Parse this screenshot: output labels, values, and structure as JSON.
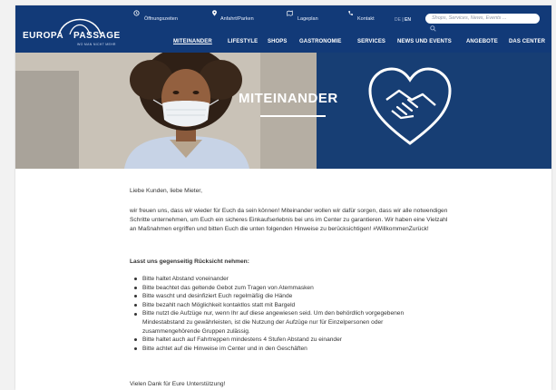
{
  "header": {
    "logo": {
      "line1": "EUROPA",
      "line2": "PASSAGE",
      "tagline": "WO MAN NICHT MEHR"
    },
    "utility": [
      {
        "icon": "clock-icon",
        "label": "Öffnungszeiten"
      },
      {
        "icon": "location-pin-icon",
        "label": "Anfahrt/Parken"
      },
      {
        "icon": "map-icon",
        "label": "Lageplan"
      },
      {
        "icon": "phone-icon",
        "label": "Kontakt"
      }
    ],
    "lang": {
      "de": "DE",
      "en": "EN"
    },
    "search_placeholder": "Shops, Services, News, Events ...",
    "nav": [
      {
        "label": "MITEINANDER"
      },
      {
        "label": "LIFESTYLE"
      },
      {
        "label": "SHOPS"
      },
      {
        "label": "GASTRONOMIE"
      },
      {
        "label": "SERVICES"
      },
      {
        "label": "NEWS UND EVENTS"
      },
      {
        "label": "ANGEBOTE"
      },
      {
        "label": "DAS CENTER"
      }
    ],
    "colors": {
      "bar": "#123a78",
      "hero": "#173e74"
    }
  },
  "hero": {
    "title": "MITEINANDER",
    "icon": "heart-handshake-icon"
  },
  "content": {
    "greeting": "Liebe Kunden, liebe Mieter,",
    "intro": "wir freuen uns, dass wir wieder für Euch da sein können! Miteinander wollen wir dafür sorgen, dass wir alle notwendigen Schritte unternehmen, um Euch ein sicheres Einkaufserlebnis bei uns im Center zu garantieren. Wir haben eine Vielzahl an Maßnahmen ergriffen und bitten Euch die unten folgenden Hinweise zu berücksichtigen! #WillkommenZurück!",
    "heading": "Lasst uns gegenseitig Rücksicht nehmen:",
    "rules": [
      "Bitte haltet Abstand voneinander",
      "Bitte beachtet das geltende Gebot zum Tragen von Atemmasken",
      "Bitte wascht und desinfiziert Euch regelmäßig die Hände",
      "Bitte bezahlt nach Möglichkeit kontaktlos statt mit Bargeld",
      "Bitte nutzt die Aufzüge nur, wenn Ihr auf diese angewiesen seid. Um den behördlich vorgegebenen Mindestabstand zu gewährleisten, ist die Nutzung der Aufzüge nur für Einzelpersonen oder zusammengehörende Gruppen zulässig.",
      "Bitte haltet auch auf Fahrtreppen mindestens 4 Stufen Abstand zu einander",
      "Bitte achtet auf die Hinweise im Center und in den Geschäften"
    ],
    "thanks": "Vielen Dank für Eure Unterstützung!"
  }
}
